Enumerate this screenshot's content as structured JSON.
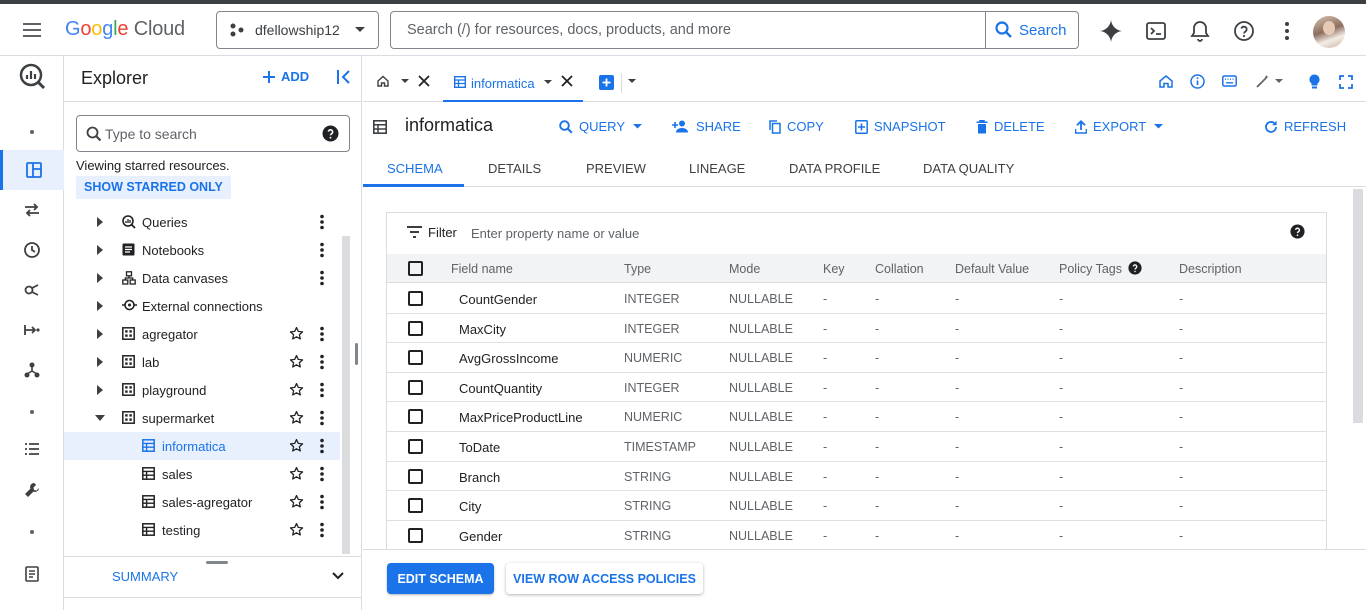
{
  "topbar": {
    "logo_google": "Google",
    "logo_cloud": "Cloud",
    "project": "dfellowship12",
    "search_placeholder": "Search (/) for resources, docs, products, and more",
    "search_button": "Search"
  },
  "explorer": {
    "title": "Explorer",
    "add_label": "ADD",
    "search_placeholder": "Type to search",
    "note": "Viewing starred resources.",
    "show_starred": "SHOW STARRED ONLY",
    "items": [
      {
        "label": "Queries",
        "icon": "queries-icon"
      },
      {
        "label": "Notebooks",
        "icon": "notebook-icon"
      },
      {
        "label": "Data canvases",
        "icon": "data-canvas-icon"
      },
      {
        "label": "External connections",
        "icon": "external-connection-icon"
      },
      {
        "label": "agregator",
        "icon": "dataset-icon"
      },
      {
        "label": "lab",
        "icon": "dataset-icon"
      },
      {
        "label": "playground",
        "icon": "dataset-icon"
      },
      {
        "label": "supermarket",
        "icon": "dataset-icon"
      },
      {
        "label": "informatica",
        "icon": "table-icon"
      },
      {
        "label": "sales",
        "icon": "table-icon"
      },
      {
        "label": "sales-agregator",
        "icon": "table-icon"
      },
      {
        "label": "testing",
        "icon": "table-icon"
      }
    ],
    "summary": "SUMMARY"
  },
  "tabs": {
    "active": "informatica"
  },
  "table": {
    "title": "informatica",
    "actions": {
      "query": "QUERY",
      "share": "SHARE",
      "copy": "COPY",
      "snapshot": "SNAPSHOT",
      "delete": "DELETE",
      "export": "EXPORT",
      "refresh": "REFRESH"
    },
    "subtabs": [
      "SCHEMA",
      "DETAILS",
      "PREVIEW",
      "LINEAGE",
      "DATA PROFILE",
      "DATA QUALITY"
    ]
  },
  "schema": {
    "filter_label": "Filter",
    "filter_placeholder": "Enter property name or value",
    "columns": [
      "Field name",
      "Type",
      "Mode",
      "Key",
      "Collation",
      "Default Value",
      "Policy Tags",
      "Description"
    ],
    "rows": [
      {
        "name": "CountGender",
        "type": "INTEGER",
        "mode": "NULLABLE",
        "key": "-",
        "collation": "-",
        "default": "-",
        "policy": "-",
        "description": "-"
      },
      {
        "name": "MaxCity",
        "type": "INTEGER",
        "mode": "NULLABLE",
        "key": "-",
        "collation": "-",
        "default": "-",
        "policy": "-",
        "description": "-"
      },
      {
        "name": "AvgGrossIncome",
        "type": "NUMERIC",
        "mode": "NULLABLE",
        "key": "-",
        "collation": "-",
        "default": "-",
        "policy": "-",
        "description": "-"
      },
      {
        "name": "CountQuantity",
        "type": "INTEGER",
        "mode": "NULLABLE",
        "key": "-",
        "collation": "-",
        "default": "-",
        "policy": "-",
        "description": "-"
      },
      {
        "name": "MaxPriceProductLine",
        "type": "NUMERIC",
        "mode": "NULLABLE",
        "key": "-",
        "collation": "-",
        "default": "-",
        "policy": "-",
        "description": "-"
      },
      {
        "name": "ToDate",
        "type": "TIMESTAMP",
        "mode": "NULLABLE",
        "key": "-",
        "collation": "-",
        "default": "-",
        "policy": "-",
        "description": "-"
      },
      {
        "name": "Branch",
        "type": "STRING",
        "mode": "NULLABLE",
        "key": "-",
        "collation": "-",
        "default": "-",
        "policy": "-",
        "description": "-"
      },
      {
        "name": "City",
        "type": "STRING",
        "mode": "NULLABLE",
        "key": "-",
        "collation": "-",
        "default": "-",
        "policy": "-",
        "description": "-"
      },
      {
        "name": "Gender",
        "type": "STRING",
        "mode": "NULLABLE",
        "key": "-",
        "collation": "-",
        "default": "-",
        "policy": "-",
        "description": "-"
      }
    ]
  },
  "footer": {
    "edit_schema": "EDIT SCHEMA",
    "row_access": "VIEW ROW ACCESS POLICIES"
  },
  "colors": {
    "accent": "#1a73e8",
    "selected_bg": "#e8f0fe"
  }
}
